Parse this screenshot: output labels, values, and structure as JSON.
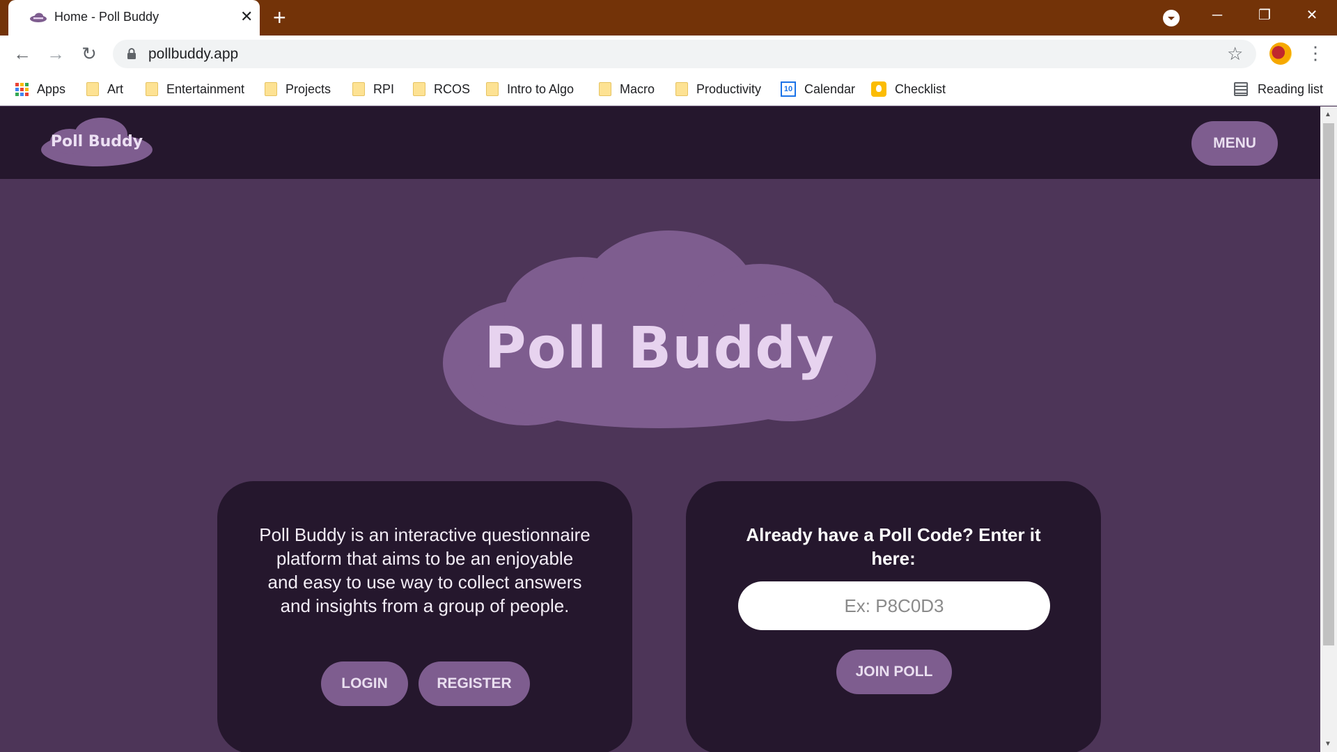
{
  "browser": {
    "tab_title": "Home - Poll Buddy",
    "tab_close": "✕",
    "new_tab": "+",
    "window_controls": {
      "minimize": "─",
      "restore": "❐",
      "close": "✕"
    },
    "nav": {
      "back": "←",
      "forward": "→",
      "reload": "↻"
    },
    "url": "pollbuddy.app",
    "star": "☆",
    "menu": "⋮",
    "bookmarks": [
      "Apps",
      "Art",
      "Entertainment",
      "Projects",
      "RPI",
      "RCOS",
      "Intro to Algo",
      "Macro",
      "Productivity",
      "Calendar",
      "Checklist"
    ],
    "calendar_badge": "10",
    "reading_list": "Reading list"
  },
  "header": {
    "logo_text": "Poll Buddy",
    "menu_label": "MENU"
  },
  "hero": {
    "logo_text": "Poll Buddy"
  },
  "about_card": {
    "description": "Poll Buddy is an interactive questionnaire platform that aims to be an enjoyable and easy to use way to collect answers and insights from a group of people.",
    "login_label": "LOGIN",
    "register_label": "REGISTER"
  },
  "join_card": {
    "heading": "Already have a Poll Code? Enter it here:",
    "code_placeholder": "Ex: P8C0D3",
    "code_value": "",
    "join_label": "JOIN POLL"
  },
  "colors": {
    "tabstrip": "#733308",
    "page_bg": "#4d3558",
    "header_bg": "#25172d",
    "card_bg": "#25172d",
    "cloud": "#7e5d8f",
    "cloud_text": "#e7d3ef",
    "button": "#7e5d8f"
  },
  "icons": {
    "favicon": "poll-buddy-cloud-icon",
    "lock": "lock-icon",
    "profile": "profile-avatar-icon",
    "apps": "apps-grid-icon",
    "folder": "folder-icon",
    "calendar": "google-calendar-icon",
    "checklist": "google-keep-icon",
    "reading_list": "reading-list-icon"
  }
}
